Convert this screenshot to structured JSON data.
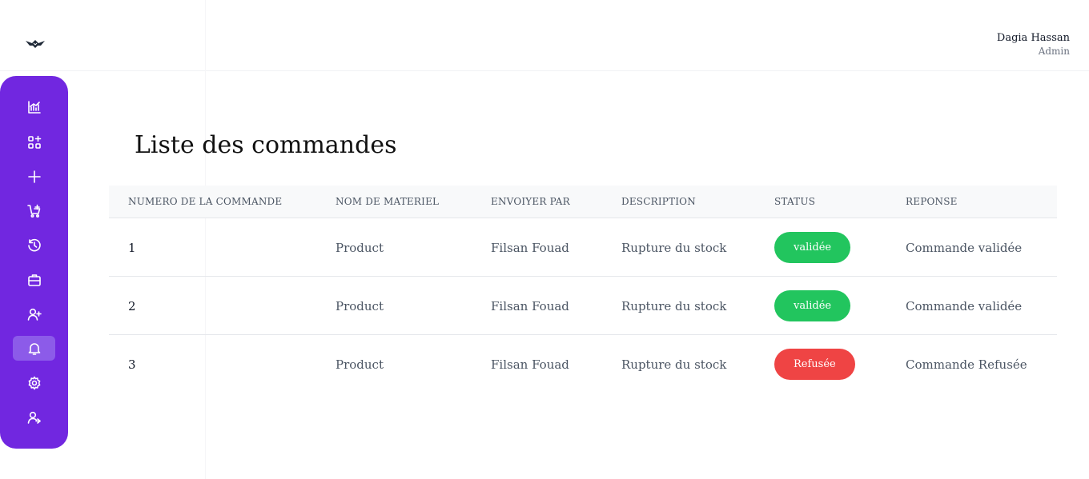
{
  "header": {
    "logo_icon": "eagle-logo-icon",
    "user_name": "Dagia Hassan",
    "user_role": "Admin"
  },
  "sidebar": {
    "accent_color": "#7127e0",
    "active_color": "#8c5be9",
    "items": [
      {
        "icon": "chart-icon"
      },
      {
        "icon": "apps-add-icon"
      },
      {
        "icon": "plus-icon"
      },
      {
        "icon": "cart-icon"
      },
      {
        "icon": "history-icon"
      },
      {
        "icon": "briefcase-icon"
      },
      {
        "icon": "user-add-icon"
      },
      {
        "icon": "bell-icon",
        "active": true
      },
      {
        "icon": "gear-icon"
      },
      {
        "icon": "user-logout-icon"
      }
    ]
  },
  "main": {
    "title": "Liste des commandes",
    "table": {
      "columns": [
        "NUMERO DE LA COMMANDE",
        "NOM DE MATERIEL",
        "ENVOIYER PAR",
        "DESCRIPTION",
        "STATUS",
        "REPONSE"
      ],
      "rows": [
        {
          "numero": "1",
          "materiel": "Product",
          "envoye_par": "Filsan Fouad",
          "description": "Rupture du stock",
          "status": "validée",
          "status_color": "#22c55e",
          "reponse": "Commande validée"
        },
        {
          "numero": "2",
          "materiel": "Product",
          "envoye_par": "Filsan Fouad",
          "description": "Rupture du stock",
          "status": "validée",
          "status_color": "#22c55e",
          "reponse": "Commande validée"
        },
        {
          "numero": "3",
          "materiel": "Product",
          "envoye_par": "Filsan Fouad",
          "description": "Rupture du stock",
          "status": "Refusée",
          "status_color": "#ef4444",
          "reponse": "Commande Refusée"
        }
      ]
    }
  }
}
